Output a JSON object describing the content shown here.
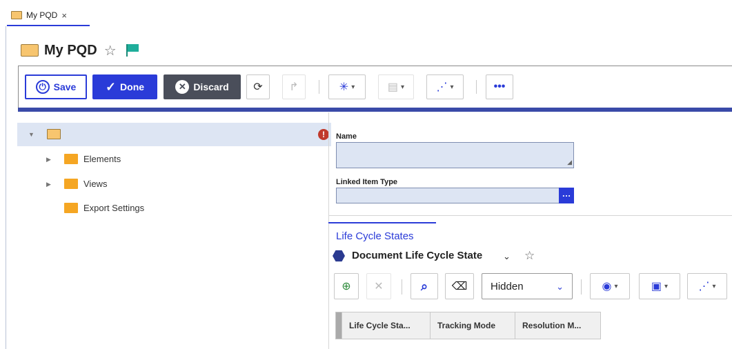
{
  "tab": {
    "label": "My PQD",
    "close": "×"
  },
  "header": {
    "title": "My PQD"
  },
  "toolbar": {
    "save_label": "Save",
    "done_label": "Done",
    "discard_label": "Discard"
  },
  "tree": {
    "root_warning": "!",
    "items": [
      {
        "label": "Elements"
      },
      {
        "label": "Views"
      },
      {
        "label": "Export Settings"
      }
    ]
  },
  "form": {
    "name_label": "Name",
    "name_value": "",
    "linked_item_type_label": "Linked Item Type",
    "linked_item_type_value": ""
  },
  "relationships": {
    "tab_label": "Life Cycle States",
    "view_name": "Document Life Cycle State",
    "filter_value": "Hidden",
    "columns": [
      "Life Cycle Sta...",
      "Tracking Mode",
      "Resolution M..."
    ]
  },
  "colors": {
    "accent": "#2a3bd8",
    "folder": "#f5a623",
    "field_bg": "#dde5f3",
    "warning": "#c0392b"
  }
}
